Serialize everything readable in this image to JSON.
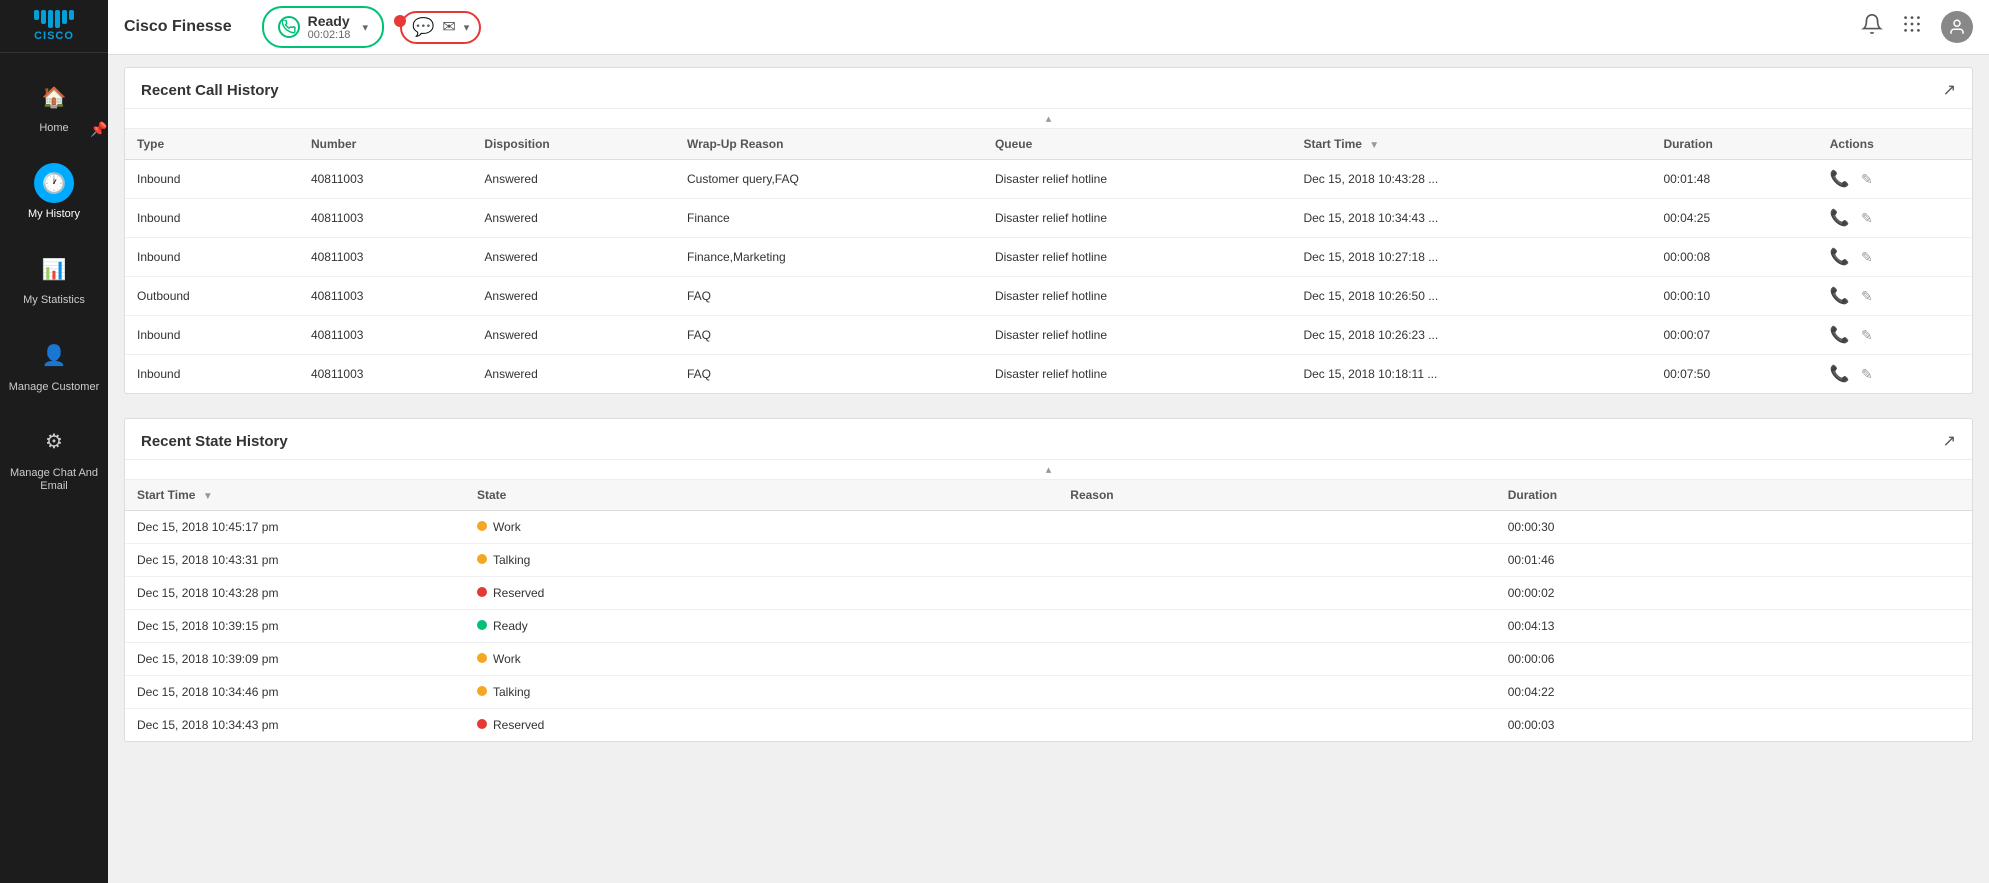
{
  "app": {
    "title": "Cisco Finesse"
  },
  "topbar": {
    "status": {
      "label": "Ready",
      "time": "00:02:18"
    },
    "channel_chevron": "▾"
  },
  "sidebar": {
    "pin_label": "📌",
    "items": [
      {
        "id": "home",
        "label": "Home",
        "icon": "🏠",
        "active": false
      },
      {
        "id": "my-history",
        "label": "My History",
        "icon": "🕐",
        "active": true
      },
      {
        "id": "my-statistics",
        "label": "My Statistics",
        "icon": "📊",
        "active": false
      },
      {
        "id": "manage-customer",
        "label": "Manage Customer",
        "icon": "👤",
        "active": false
      },
      {
        "id": "manage-chat-email",
        "label": "Manage Chat And Email",
        "icon": "⚙",
        "active": false
      }
    ]
  },
  "call_history": {
    "title": "Recent Call History",
    "columns": [
      "Type",
      "Number",
      "Disposition",
      "Wrap-Up Reason",
      "Queue",
      "Start Time",
      "Duration",
      "Actions"
    ],
    "rows": [
      {
        "type": "Inbound",
        "number": "40811003",
        "disposition": "Answered",
        "wrap_up": "Customer query,FAQ",
        "queue": "Disaster relief hotline",
        "start_time": "Dec 15, 2018 10:43:28 ...",
        "duration": "00:01:48"
      },
      {
        "type": "Inbound",
        "number": "40811003",
        "disposition": "Answered",
        "wrap_up": "Finance",
        "queue": "Disaster relief hotline",
        "start_time": "Dec 15, 2018 10:34:43 ...",
        "duration": "00:04:25"
      },
      {
        "type": "Inbound",
        "number": "40811003",
        "disposition": "Answered",
        "wrap_up": "Finance,Marketing",
        "queue": "Disaster relief hotline",
        "start_time": "Dec 15, 2018 10:27:18 ...",
        "duration": "00:00:08"
      },
      {
        "type": "Outbound",
        "number": "40811003",
        "disposition": "Answered",
        "wrap_up": "FAQ",
        "queue": "Disaster relief hotline",
        "start_time": "Dec 15, 2018 10:26:50 ...",
        "duration": "00:00:10"
      },
      {
        "type": "Inbound",
        "number": "40811003",
        "disposition": "Answered",
        "wrap_up": "FAQ",
        "queue": "Disaster relief hotline",
        "start_time": "Dec 15, 2018 10:26:23 ...",
        "duration": "00:00:07"
      },
      {
        "type": "Inbound",
        "number": "40811003",
        "disposition": "Answered",
        "wrap_up": "FAQ",
        "queue": "Disaster relief hotline",
        "start_time": "Dec 15, 2018 10:18:11 ...",
        "duration": "00:07:50"
      }
    ]
  },
  "state_history": {
    "title": "Recent State History",
    "columns": [
      "Start Time",
      "State",
      "Reason",
      "Duration"
    ],
    "rows": [
      {
        "start_time": "Dec 15, 2018 10:45:17 pm",
        "state": "Work",
        "dot": "yellow",
        "reason": "",
        "duration": "00:00:30"
      },
      {
        "start_time": "Dec 15, 2018 10:43:31 pm",
        "state": "Talking",
        "dot": "yellow",
        "reason": "",
        "duration": "00:01:46"
      },
      {
        "start_time": "Dec 15, 2018 10:43:28 pm",
        "state": "Reserved",
        "dot": "red",
        "reason": "",
        "duration": "00:00:02"
      },
      {
        "start_time": "Dec 15, 2018 10:39:15 pm",
        "state": "Ready",
        "dot": "green",
        "reason": "",
        "duration": "00:04:13"
      },
      {
        "start_time": "Dec 15, 2018 10:39:09 pm",
        "state": "Work",
        "dot": "yellow",
        "reason": "",
        "duration": "00:00:06"
      },
      {
        "start_time": "Dec 15, 2018 10:34:46 pm",
        "state": "Talking",
        "dot": "yellow",
        "reason": "",
        "duration": "00:04:22"
      },
      {
        "start_time": "Dec 15, 2018 10:34:43 pm",
        "state": "Reserved",
        "dot": "red",
        "reason": "",
        "duration": "00:00:03"
      }
    ]
  }
}
